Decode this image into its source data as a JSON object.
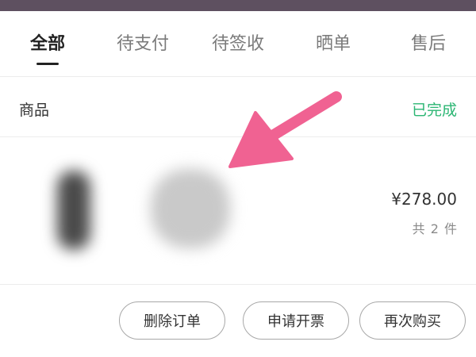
{
  "tabs": [
    {
      "label": "全部",
      "active": true
    },
    {
      "label": "待支付",
      "active": false
    },
    {
      "label": "待签收",
      "active": false
    },
    {
      "label": "晒单",
      "active": false
    },
    {
      "label": "售后",
      "active": false
    }
  ],
  "order": {
    "section_label": "商品",
    "status": "已完成",
    "status_color": "#2bb673",
    "price": "¥278.00",
    "item_count": "共 2 件"
  },
  "actions": {
    "delete_label": "删除订单",
    "invoice_label": "申请开票",
    "rebuy_label": "再次购买"
  },
  "colors": {
    "annotation_arrow": "#f06292",
    "status_bar": "#5e5060"
  }
}
